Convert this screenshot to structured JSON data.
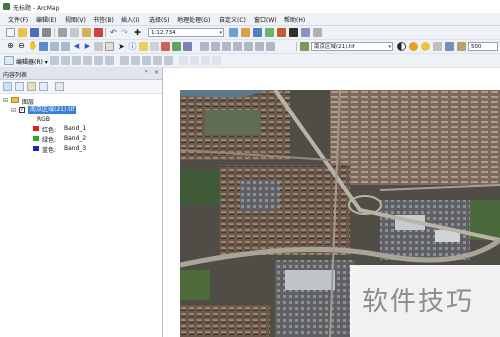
{
  "window": {
    "title": "无标题 - ArcMap"
  },
  "menu": [
    "文件(F)",
    "编辑(E)",
    "视图(V)",
    "书签(B)",
    "插入(I)",
    "选择(S)",
    "地理处理(G)",
    "自定义(C)",
    "窗口(W)",
    "帮助(H)"
  ],
  "toolbar": {
    "scale_value": "1:12,734",
    "layer_combo": "南京区域(21).tif",
    "number_value": "500",
    "editor_label": "编辑器(R) ▾"
  },
  "toc": {
    "title": "内容列表",
    "pin": "ᵖ",
    "close": "×",
    "tree": {
      "group": "图层",
      "layer": "南京区域(21).tif",
      "rgb_label": "RGB",
      "bands": [
        {
          "label": "红色:",
          "band": "Band_1",
          "color": "#e02020"
        },
        {
          "label": "绿色:",
          "band": "Band_2",
          "color": "#20b020"
        },
        {
          "label": "蓝色:",
          "band": "Band_3",
          "color": "#2020c8"
        }
      ]
    }
  },
  "watermark": "软件技巧"
}
